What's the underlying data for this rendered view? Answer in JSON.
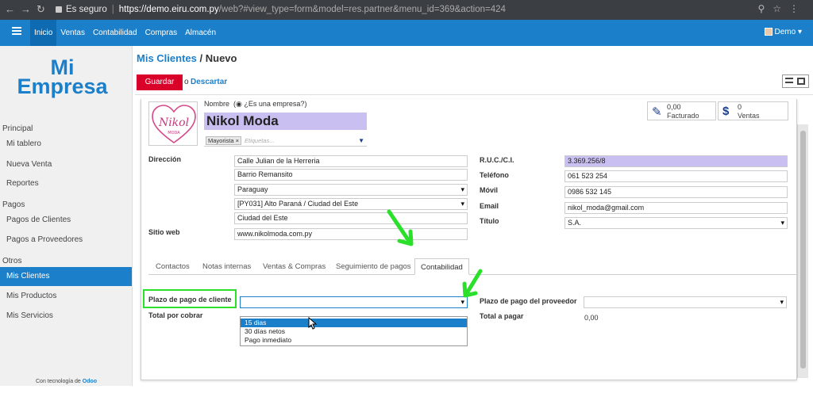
{
  "browser": {
    "security_label": "Es seguro",
    "url_host": "https://demo.eiru.com.py",
    "url_path": "/web?#view_type=form&model=res.partner&menu_id=369&action=424"
  },
  "appbar": {
    "menu": [
      "Inicio",
      "Ventas",
      "Contabilidad",
      "Compras",
      "Almacén"
    ],
    "active_menu": "Inicio",
    "user": "Demo"
  },
  "sidebar": {
    "logo_line1": "Mi",
    "logo_line2": "Empresa",
    "sections": [
      {
        "header": "Principal",
        "items": [
          "Mi tablero",
          "Nueva Venta",
          "Reportes"
        ]
      },
      {
        "header": "Pagos",
        "items": [
          "Pagos de Clientes",
          "Pagos a Proveedores"
        ]
      },
      {
        "header": "Otros",
        "items": [
          "Mis Clientes",
          "Mis Productos",
          "Mis Servicios"
        ]
      }
    ],
    "active_item": "Mis Clientes",
    "footer_prefix": "Con tecnología de",
    "footer_brand": "Odoo"
  },
  "header": {
    "breadcrumb_parent": "Mis Clientes",
    "breadcrumb_sep": "/",
    "breadcrumb_current": "Nuevo",
    "save_label": "Guardar",
    "or_label": "o",
    "discard_label": "Descartar"
  },
  "form": {
    "avatar_text": "Nikol",
    "avatar_sub": "MODA",
    "nombre_label": "Nombre",
    "company_check_label": "¿Es una empresa?",
    "name": "Nikol Moda",
    "tag": "Mayorista",
    "tags_placeholder": "Etiquetas...",
    "stats": [
      {
        "value": "0,00",
        "label": "Facturado",
        "icon": "pencil-square-icon"
      },
      {
        "value": "0",
        "label": "Ventas",
        "icon": "dollar-icon"
      }
    ],
    "address_label": "Dirección",
    "street": "Calle Julian de la Herreria",
    "street2": "Barrio Remansito",
    "country": "Paraguay",
    "state": "[PY031] Alto Paraná / Ciudad del Este",
    "city": "Ciudad del Este",
    "website_label": "Sitio web",
    "website": "www.nikolmoda.com.py",
    "ruc_label": "R.U.C./C.I.",
    "ruc": "3.369.256/8",
    "phone_label": "Teléfono",
    "phone": "061 523 254",
    "mobile_label": "Móvil",
    "mobile": "0986 532 145",
    "email_label": "Email",
    "email": "nikol_moda@gmail.com",
    "title_label": "Título",
    "title": "S.A."
  },
  "tabs": [
    "Contactos",
    "Notas internas",
    "Ventas & Compras",
    "Seguimiento de pagos",
    "Contabilidad"
  ],
  "active_tab": "Contabilidad",
  "accounting": {
    "customer_term_label": "Plazo de pago de cliente",
    "customer_term_value": "",
    "receivable_label": "Total por cobrar",
    "supplier_term_label": "Plazo de pago del proveedor",
    "supplier_term_value": "",
    "payable_label": "Total a pagar",
    "payable_value": "0,00",
    "dropdown_options": [
      "15 dias",
      "30 días netos",
      "Pago inmediato"
    ],
    "hovered_option": "15 dias"
  },
  "colors": {
    "brand_blue": "#1c7fc9",
    "save_red": "#d9002a",
    "highlight_purple": "#c9bff0",
    "annotation_green": "#2be02b"
  }
}
